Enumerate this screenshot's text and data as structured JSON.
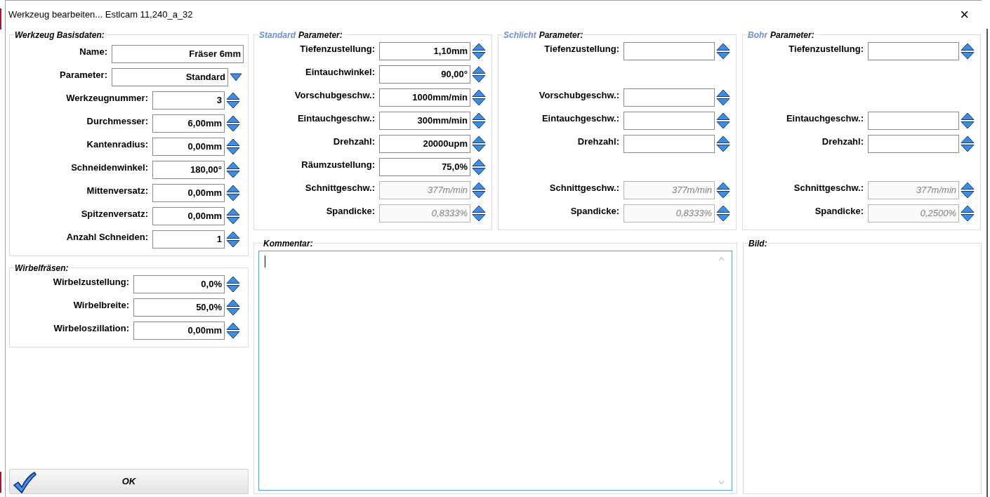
{
  "window": {
    "title": "Werkzeug bearbeiten... Estlcam 11,240_a_32",
    "close": "×"
  },
  "basic": {
    "title": "Werkzeug Basisdaten:",
    "fields": [
      {
        "kind": "text",
        "label": "Name:",
        "value": "Fräser 6mm",
        "disabled": false
      },
      {
        "kind": "dropdown",
        "label": "Parameter:",
        "value": "Standard",
        "disabled": false
      },
      {
        "kind": "spin",
        "label": "Werkzeugnummer:",
        "value": "3",
        "disabled": false
      },
      {
        "kind": "spin",
        "label": "Durchmesser:",
        "value": "6,00mm",
        "disabled": false
      },
      {
        "kind": "spin",
        "label": "Kantenradius:",
        "value": "0,00mm",
        "disabled": false
      },
      {
        "kind": "spin",
        "label": "Schneidenwinkel:",
        "value": "180,00°",
        "disabled": false
      },
      {
        "kind": "spin",
        "label": "Mittenversatz:",
        "value": "0,00mm",
        "disabled": false
      },
      {
        "kind": "spin",
        "label": "Spitzenversatz:",
        "value": "0,00mm",
        "disabled": false
      },
      {
        "kind": "spin",
        "label": "Anzahl Schneiden:",
        "value": "1",
        "disabled": false
      }
    ]
  },
  "swirl": {
    "title": "Wirbelfräsen:",
    "fields": [
      {
        "label": "Wirbelzustellung:",
        "value": "0,0%",
        "disabled": false
      },
      {
        "label": "Wirbelbreite:",
        "value": "50,0%",
        "disabled": false
      },
      {
        "label": "Wirbeloszillation:",
        "value": "0,00mm",
        "disabled": false
      }
    ]
  },
  "parameter_groups": [
    {
      "mode": "Standard",
      "title": "Parameter:",
      "fields": [
        {
          "kind": "depth",
          "label": "Tiefenzustellung:",
          "value": "1,10mm",
          "disabled": false
        },
        {
          "kind": "angle",
          "label": "Eintauchwinkel:",
          "value": "90,00°",
          "disabled": false
        },
        {
          "kind": "feed",
          "label": "Vorschubgeschw.:",
          "value": "1000mm/min",
          "disabled": false
        },
        {
          "kind": "plunge",
          "label": "Eintauchgeschw.:",
          "value": "300mm/min",
          "disabled": false
        },
        {
          "kind": "speed",
          "label": "Drehzahl:",
          "value": "20000upm",
          "disabled": false
        },
        {
          "kind": "stepover",
          "label": "Räumzustellung:",
          "value": "75,0%",
          "disabled": false
        },
        {
          "kind": "cutspeed",
          "label": "Schnittgeschw.:",
          "value": "377m/min",
          "disabled": true
        },
        {
          "kind": "chip",
          "label": "Spandicke:",
          "value": "0,8333%",
          "disabled": true
        }
      ]
    },
    {
      "mode": "Schlicht",
      "title": "Parameter:",
      "fields": [
        {
          "kind": "depth",
          "label": "Tiefenzustellung:",
          "disabled": false
        },
        {
          "kind": "feed",
          "label": "Vorschubgeschw.:",
          "disabled": false
        },
        {
          "kind": "plunge",
          "label": "Eintauchgeschw.:",
          "disabled": false
        },
        {
          "kind": "speed",
          "label": "Drehzahl:",
          "disabled": false
        },
        {
          "kind": "cutspeed",
          "label": "Schnittgeschw.:",
          "value": "377m/min",
          "disabled": true
        },
        {
          "kind": "chip",
          "label": "Spandicke:",
          "value": "0,8333%",
          "disabled": true
        }
      ]
    },
    {
      "mode": "Bohr",
      "title": "Parameter:",
      "fields": [
        {
          "kind": "depth",
          "label": "Tiefenzustellung:",
          "disabled": false
        },
        {
          "kind": "plunge",
          "label": "Eintauchgeschw.:",
          "disabled": false
        },
        {
          "kind": "speed",
          "label": "Drehzahl:",
          "disabled": false
        },
        {
          "kind": "cutspeed",
          "label": "Schnittgeschw.:",
          "value": "377m/min",
          "disabled": true
        },
        {
          "kind": "chip",
          "label": "Spandicke:",
          "value": "0,2500%",
          "disabled": true
        }
      ]
    }
  ],
  "comment": {
    "title": "Kommentar:",
    "focused": true
  },
  "image": {
    "title": "Bild:"
  },
  "ok_button": {
    "label": "OK"
  }
}
